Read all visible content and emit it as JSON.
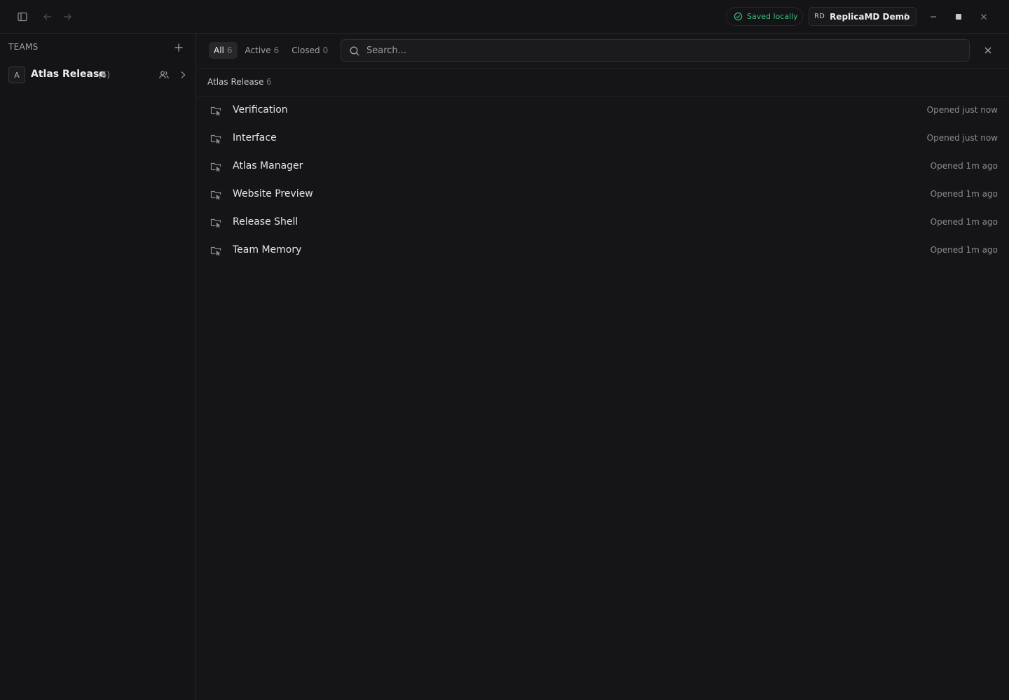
{
  "titlebar": {
    "status_label": "Saved locally",
    "workspace_initials": "RD",
    "workspace_name": "ReplicaMD Demo"
  },
  "sidebar": {
    "header": "TEAMS",
    "teams": [
      {
        "initial": "A",
        "name": "Atlas Release",
        "count": "(6)"
      }
    ]
  },
  "filters": [
    {
      "label": "All",
      "count": "6"
    },
    {
      "label": "Active",
      "count": "6"
    },
    {
      "label": "Closed",
      "count": "0"
    }
  ],
  "active_filter": "All",
  "search": {
    "placeholder": "Search...",
    "value": ""
  },
  "group": {
    "title": "Atlas Release",
    "count": "6",
    "sessions": [
      {
        "title": "Verification",
        "time": "Opened just now"
      },
      {
        "title": "Interface",
        "time": "Opened just now"
      },
      {
        "title": "Atlas Manager",
        "time": "Opened 1m ago"
      },
      {
        "title": "Website Preview",
        "time": "Opened 1m ago"
      },
      {
        "title": "Release Shell",
        "time": "Opened 1m ago"
      },
      {
        "title": "Team Memory",
        "time": "Opened 1m ago"
      }
    ]
  },
  "colors": {
    "background": "#151517",
    "accent_green": "#34c07b",
    "border": "#26262a"
  },
  "icons": {
    "sidebar_toggle": "sidebar-toggle-icon",
    "back": "arrow-left-icon",
    "forward": "arrow-right-icon",
    "saved": "check-circle-icon",
    "workspace_switch": "chevrons-up-down-icon",
    "session": "folder-cursor-icon",
    "members": "users-icon"
  }
}
